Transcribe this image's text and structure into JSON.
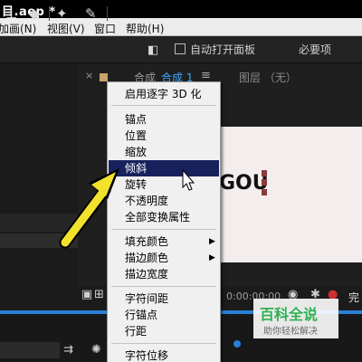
{
  "window": {
    "title": "目.aep *"
  },
  "menubar": [
    {
      "label": "加画(N)",
      "name": "menu-animation"
    },
    {
      "label": "视图(V)",
      "name": "menu-view"
    },
    {
      "label": "窗口",
      "name": "menu-window"
    },
    {
      "label": "帮助(H)",
      "name": "menu-help"
    }
  ],
  "toolbar": {
    "auto_open_label": "自动打开面板",
    "required_label": "必要项"
  },
  "comp_panel": {
    "close": "×",
    "comp_label": "合成",
    "comp_tab": "合成 1",
    "menu_glyph": "≡",
    "layer_label": "图层 （无）"
  },
  "viewer": {
    "text": "GOU"
  },
  "status": {
    "timecode": "0:00:00:00",
    "complete_label": "完"
  },
  "context_menu": {
    "items": [
      {
        "label": "启用逐字 3D 化",
        "name": "ctx-enable-per-char-3d"
      },
      {
        "label": "锚点",
        "name": "ctx-anchor-point"
      },
      {
        "label": "位置",
        "name": "ctx-position"
      },
      {
        "label": "缩放",
        "name": "ctx-scale"
      },
      {
        "label": "倾斜",
        "name": "ctx-skew",
        "active": true
      },
      {
        "label": "旋转",
        "name": "ctx-rotation"
      },
      {
        "label": "不透明度",
        "name": "ctx-opacity"
      },
      {
        "label": "全部变换属性",
        "name": "ctx-all-transform"
      },
      {
        "label": "填充颜色",
        "name": "ctx-fill-color",
        "submenu": true
      },
      {
        "label": "描边颜色",
        "name": "ctx-stroke-color",
        "submenu": true
      },
      {
        "label": "描边宽度",
        "name": "ctx-stroke-width"
      },
      {
        "label": "字符间距",
        "name": "ctx-tracking"
      },
      {
        "label": "行锚点",
        "name": "ctx-line-anchor"
      },
      {
        "label": "行距",
        "name": "ctx-line-spacing"
      },
      {
        "label": "字符位移",
        "name": "ctx-char-offset"
      }
    ]
  },
  "watermark": {
    "title": "百科全说",
    "subtitle": "助你轻松解决"
  },
  "colors": {
    "accent_blue": "#3fa6ff",
    "menu_highlight": "#17215c",
    "annotation_arrow": "#f2e22b",
    "watermark_green": "#2fb14e"
  },
  "icons": [
    "stamp-icon",
    "eraser-icon",
    "puppet-icon",
    "pin-icon",
    "panel-toggle-icon",
    "camera-icon",
    "grid-icon",
    "region-icon",
    "graph-icon",
    "sparkle-icon",
    "cursor-icon"
  ]
}
